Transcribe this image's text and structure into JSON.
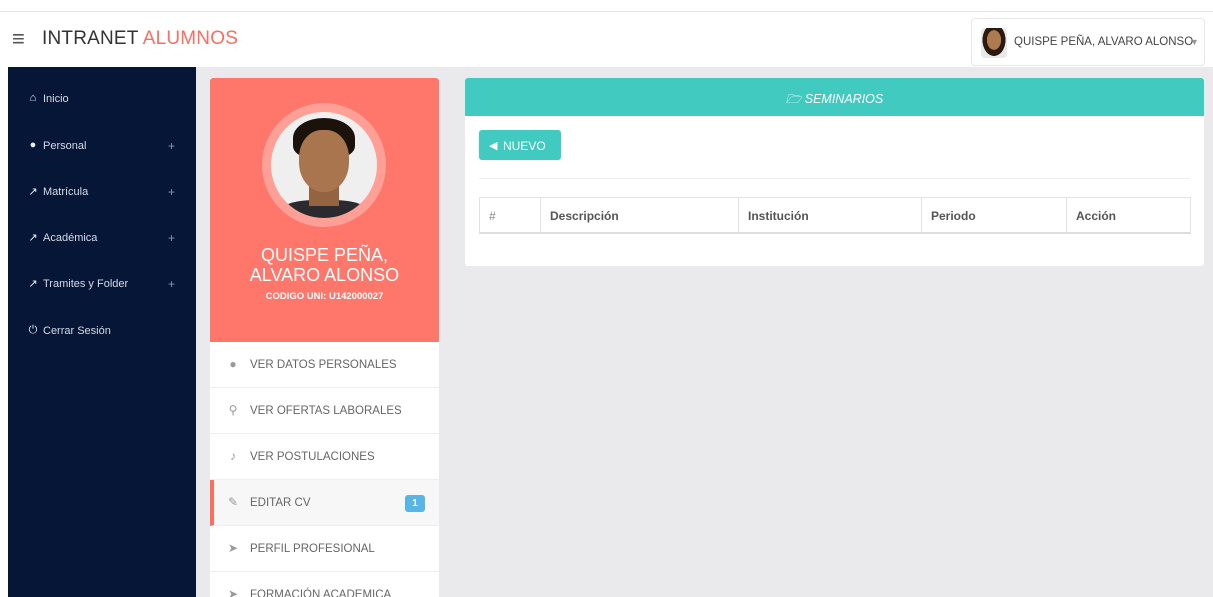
{
  "header": {
    "menu_icon": "hamburger-icon",
    "brand_main": "INTRANET",
    "brand_accent": "ALUMNOS",
    "user_name": "QUISPE PEÑA, ALVARO ALONSO",
    "caret_icon": "caret-down-icon"
  },
  "sidebar": {
    "items": [
      {
        "label": "Inicio",
        "icon": "home-icon",
        "glyph": "⌂",
        "expandable": false
      },
      {
        "label": "Personal",
        "icon": "user-icon",
        "glyph": "●",
        "expandable": true
      },
      {
        "label": "Matrícula",
        "icon": "external-link-icon",
        "glyph": "↗",
        "expandable": true
      },
      {
        "label": "Académica",
        "icon": "external-link-icon",
        "glyph": "↗",
        "expandable": true
      },
      {
        "label": "Tramites y Folder",
        "icon": "external-link-icon",
        "glyph": "↗",
        "expandable": true
      },
      {
        "label": "Cerrar Sesión",
        "icon": "power-icon",
        "glyph": "⏻",
        "expandable": false
      }
    ],
    "plus": "+"
  },
  "profile": {
    "name_line1": "QUISPE PEÑA,",
    "name_line2": "ALVARO ALONSO",
    "code": "CODIGO UNI: U142000027",
    "menu": [
      {
        "label": "VER DATOS PERSONALES",
        "icon": "user-icon",
        "glyph": "●"
      },
      {
        "label": "VER OFERTAS LABORALES",
        "icon": "search-icon",
        "glyph": "⚲"
      },
      {
        "label": "VER POSTULACIONES",
        "icon": "bell-icon",
        "glyph": "♪"
      },
      {
        "label": "EDITAR CV",
        "icon": "edit-icon",
        "glyph": "✎",
        "active": true,
        "badge": "1"
      },
      {
        "label": "PERFIL PROFESIONAL",
        "icon": "location-arrow-icon",
        "glyph": "➤"
      },
      {
        "label": "FORMACIÓN ACADEMICA",
        "icon": "location-arrow-icon",
        "glyph": "➤"
      }
    ]
  },
  "seminarios": {
    "title": "SEMINARIOS",
    "title_icon": "folder-open-icon",
    "new_button": "NUEVO",
    "new_icon": "bullhorn-icon",
    "columns": [
      "#",
      "Descripción",
      "Institución",
      "Periodo",
      "Acción"
    ]
  },
  "colors": {
    "sidebar": "#061637",
    "accent": "#ff6c60",
    "profile_header": "#ff776b",
    "teal": "#41cac0",
    "badge": "#57b6e6"
  }
}
